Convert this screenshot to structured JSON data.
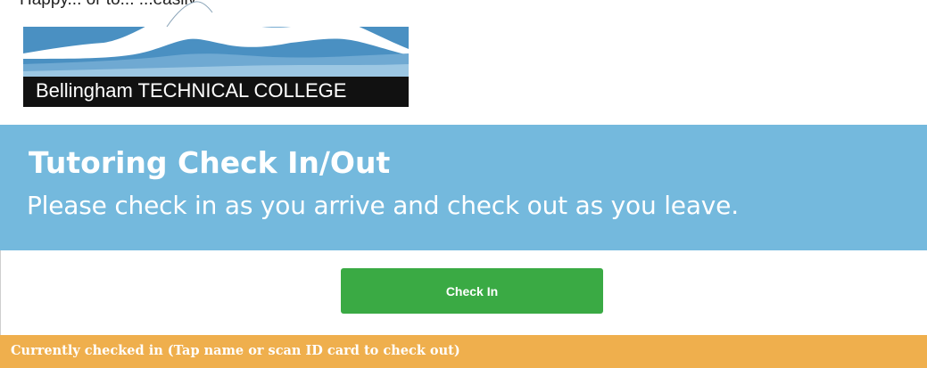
{
  "top_text": "Happy... or to...  ...easily.",
  "logo": {
    "text": "Bellingham TECHNICAL COLLEGE",
    "colors": {
      "sky": "#4a90c2",
      "mountain": "#ffffff",
      "band": "#111111"
    }
  },
  "header": {
    "title": "Tutoring Check In/Out",
    "subtitle": "Please check in as you arrive and check out as you leave.",
    "background": "#74b9dd"
  },
  "checkin": {
    "button_label": "Check In",
    "button_color": "#3aaa44"
  },
  "status_bar": {
    "text": "Currently checked in (Tap name or scan ID card to check out)",
    "background": "#efaf4d"
  }
}
